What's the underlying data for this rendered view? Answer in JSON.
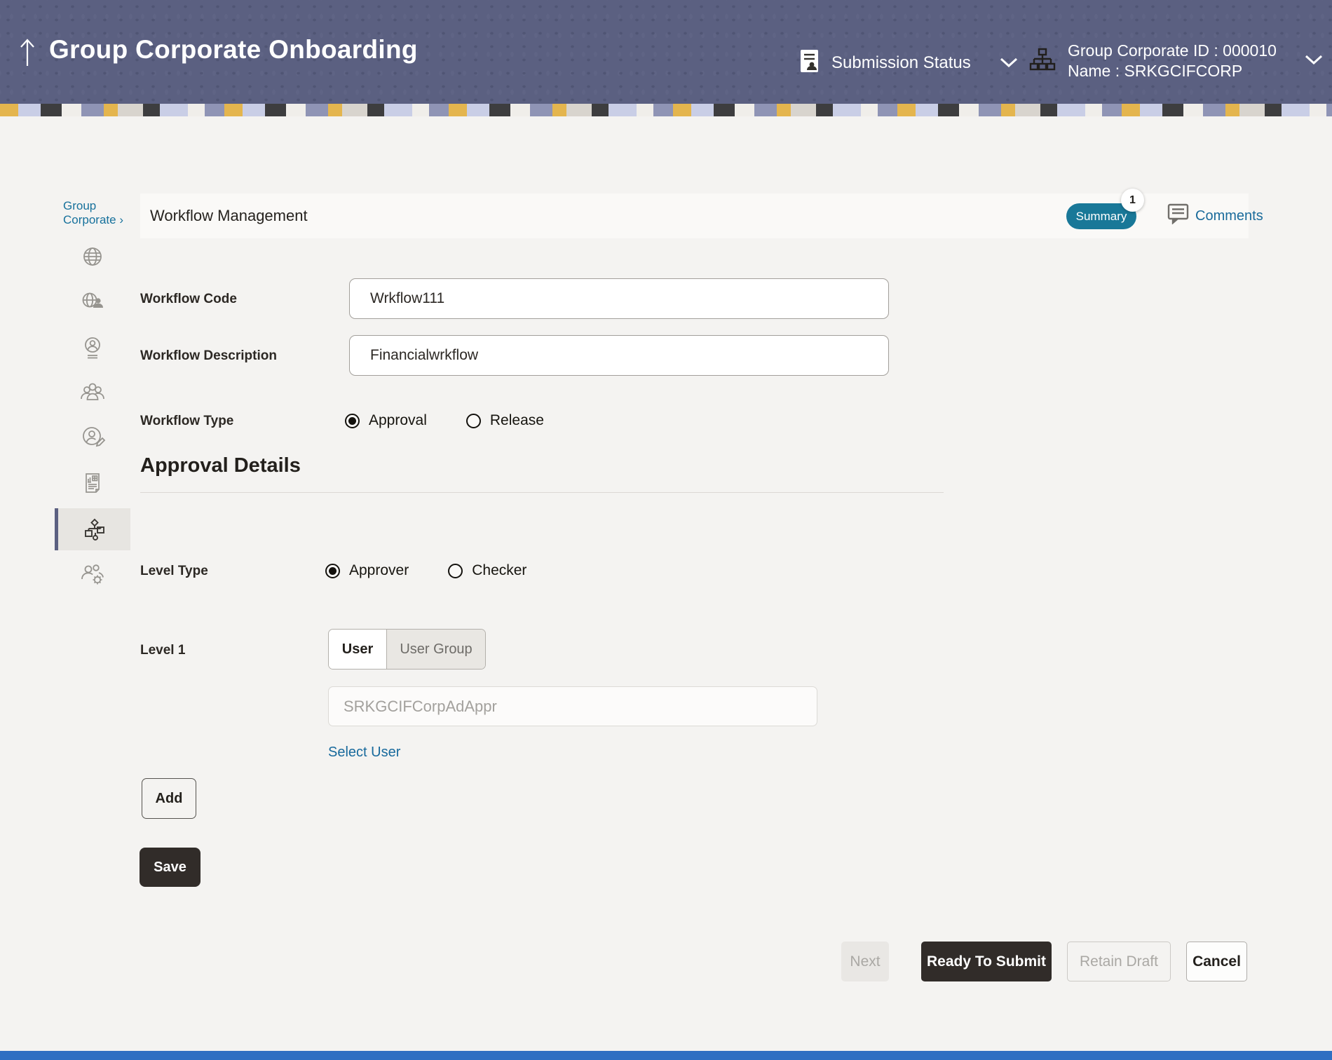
{
  "header": {
    "title": "Group Corporate Onboarding",
    "submission_status_label": "Submission Status",
    "corporate_id_line": "Group Corporate ID : 000010",
    "corporate_name_line": "Name : SRKGCIFCORP"
  },
  "sidebar": {
    "breadcrumb_label": "Group Corporate",
    "breadcrumb_chevron": "›",
    "items": [
      {
        "icon": "globe-icon",
        "selected": false
      },
      {
        "icon": "globe-user-icon",
        "selected": false
      },
      {
        "icon": "user-profile-icon",
        "selected": false
      },
      {
        "icon": "users-group-icon",
        "selected": false
      },
      {
        "icon": "user-edit-icon",
        "selected": false
      },
      {
        "icon": "report-icon",
        "selected": false
      },
      {
        "icon": "workflow-icon",
        "selected": true
      },
      {
        "icon": "user-settings-icon",
        "selected": false
      }
    ]
  },
  "page": {
    "title": "Workflow Management",
    "summary_label": "Summary",
    "summary_badge": "1",
    "comments_label": "Comments"
  },
  "form": {
    "workflow_code": {
      "label": "Workflow Code",
      "value": "Wrkflow111"
    },
    "workflow_description": {
      "label": "Workflow Description",
      "value": "Financialwrkflow"
    },
    "workflow_type": {
      "label": "Workflow Type",
      "options": [
        {
          "label": "Approval",
          "selected": true
        },
        {
          "label": "Release",
          "selected": false
        }
      ]
    },
    "section_heading": "Approval Details",
    "level_type": {
      "label": "Level Type",
      "options": [
        {
          "label": "Approver",
          "selected": true
        },
        {
          "label": "Checker",
          "selected": false
        }
      ]
    },
    "level1": {
      "label": "Level 1",
      "tabs": [
        {
          "label": "User",
          "active": true
        },
        {
          "label": "User Group",
          "active": false
        }
      ],
      "user_input_placeholder": "SRKGCIFCorpAdAppr",
      "select_user_link": "Select User"
    },
    "add_button": "Add",
    "save_button": "Save"
  },
  "footer": {
    "next": "Next",
    "ready_to_submit": "Ready To Submit",
    "retain_draft": "Retain Draft",
    "cancel": "Cancel"
  },
  "colors": {
    "header_bg": "#5b6081",
    "summary_pill": "#197898",
    "link_blue": "#1a6b9b",
    "dark_button": "#312c29"
  }
}
